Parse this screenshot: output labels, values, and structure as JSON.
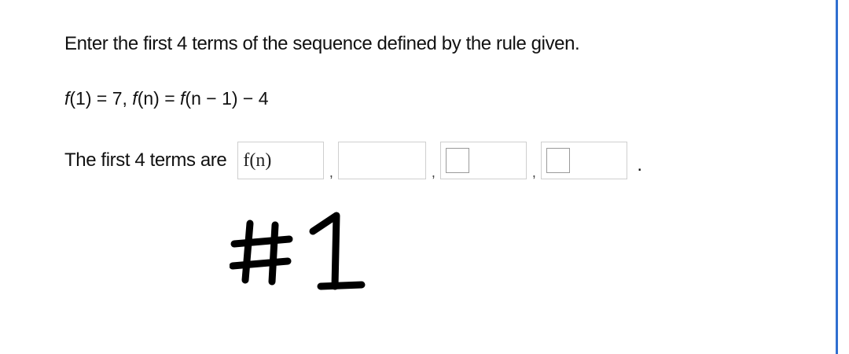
{
  "question": {
    "prompt": "Enter the first 4 terms of the sequence defined by the rule given.",
    "rule": {
      "f1": "f",
      "base_args": "(1) = 7, ",
      "f2": "f",
      "n1": "(n) = ",
      "f3": "f",
      "rest": "(n − 1) − 4"
    },
    "answer_label": "The first 4 terms are",
    "answers": [
      {
        "value": "f(n)",
        "placeholder": ""
      },
      {
        "value": "",
        "placeholder": ""
      },
      {
        "value": "",
        "placeholder": ""
      },
      {
        "value": "",
        "placeholder": ""
      }
    ],
    "separator": ",",
    "terminator": "."
  },
  "annotation": {
    "handwritten_text": "#1",
    "color": "#000000"
  },
  "colors": {
    "window_border": "#2f6fd0",
    "input_border": "#cfcfcf"
  }
}
